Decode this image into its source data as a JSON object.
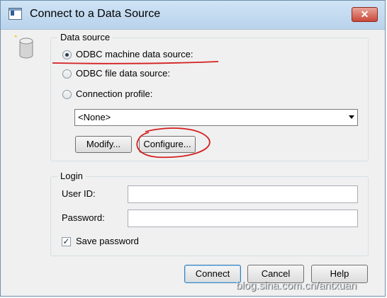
{
  "window": {
    "title": "Connect to a Data Source",
    "close_label": "✕"
  },
  "data_source": {
    "legend": "Data source",
    "options": [
      {
        "label": "ODBC machine data source:",
        "checked": true
      },
      {
        "label": "ODBC file data source:",
        "checked": false
      },
      {
        "label": "Connection profile:",
        "checked": false
      }
    ],
    "profile_select": {
      "value": "<None>"
    },
    "modify_label": "Modify...",
    "configure_label": "Configure..."
  },
  "login": {
    "legend": "Login",
    "user_id_label": "User ID:",
    "user_id_value": "",
    "password_label": "Password:",
    "password_value": "",
    "save_password_label": "Save password",
    "save_password_checked": true
  },
  "buttons": {
    "connect": "Connect",
    "cancel": "Cancel",
    "help": "Help"
  },
  "watermark": "blog.sina.com.cn/antxuan",
  "colors": {
    "annotation": "#d42020",
    "titlebar": "#c4dbf1"
  }
}
